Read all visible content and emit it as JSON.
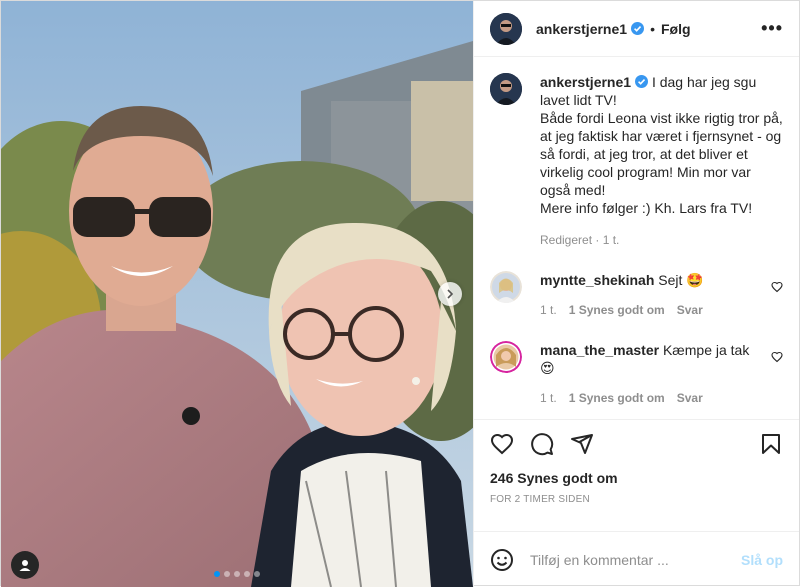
{
  "post": {
    "username": "ankerstjerne1",
    "follow_label": "Følg",
    "separator": "•",
    "more_label": "•••",
    "caption": "I dag har jeg sgu lavet lidt TV!\nBåde fordi Leona vist ikke rigtig tror på, at jeg faktisk har været i fjernsynet - og så fordi, at jeg tror, at det bliver et virkelig cool program! Min mor var også med!\nMere info følger :) Kh. Lars fra TV!",
    "caption_meta": "Redigeret · 1 t."
  },
  "comments": [
    {
      "username": "myntte_shekinah",
      "text": "Sejt 🤩",
      "age": "1 t.",
      "likes": "1 Synes godt om",
      "reply": "Svar"
    },
    {
      "username": "mana_the_master",
      "text": "Kæmpe ja tak 😍",
      "age": "1 t.",
      "likes": "1 Synes godt om",
      "reply": "Svar"
    }
  ],
  "actions": {
    "likes_label": "246 Synes godt om",
    "time_label": "FOR 2 TIMER SIDEN"
  },
  "add_comment": {
    "placeholder": "Tilføj en kommentar ...",
    "post_label": "Slå op"
  },
  "carousel": {
    "count": 5,
    "active": 0
  },
  "colors": {
    "accent": "#0095f6",
    "verified": "#3897f0",
    "muted": "#8e8e8e",
    "post_disabled": "#b2dffc"
  },
  "icons": [
    "chevron-right-icon",
    "tag-user-icon",
    "verified-badge-icon",
    "heart-icon",
    "comment-icon",
    "share-icon",
    "bookmark-icon",
    "emoji-icon"
  ]
}
